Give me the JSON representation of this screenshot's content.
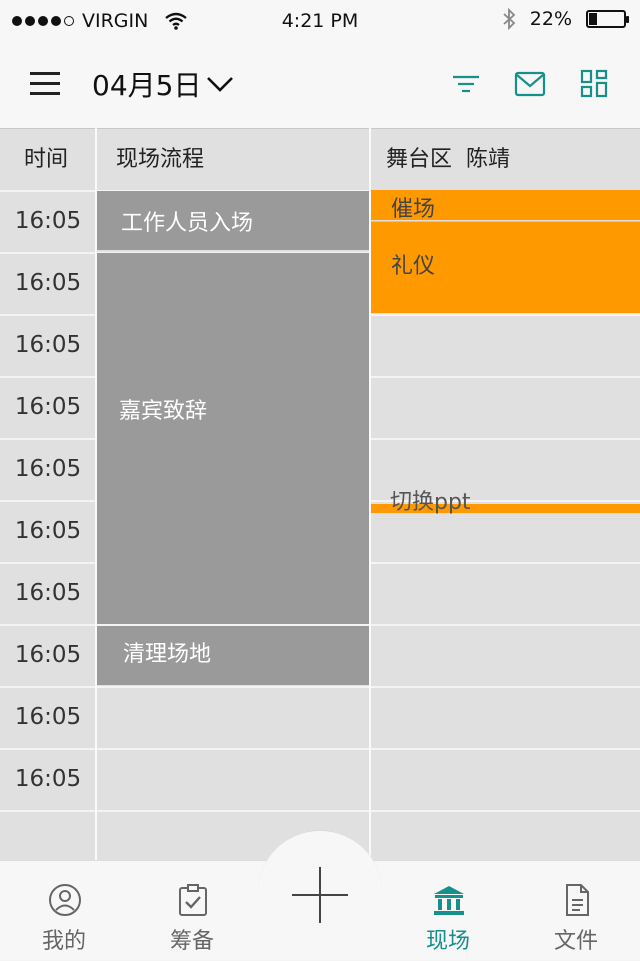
{
  "status_bar": {
    "carrier": "VIRGIN",
    "time": "4:21 PM",
    "battery": "22%",
    "battery_level": 0.22,
    "icons": [
      "signal-dots-icon",
      "wifi-icon",
      "bluetooth-icon",
      "battery-icon"
    ]
  },
  "navbar": {
    "date": "04月5日",
    "icons": [
      "menu-icon",
      "chevron-down-icon",
      "filter-icon",
      "mail-icon",
      "grid-icon"
    ],
    "accent_color": "#17908b"
  },
  "table": {
    "headers": [
      "时间",
      "现场流程",
      "舞台区  陈靖"
    ],
    "times": [
      "16:05",
      "16:05",
      "16:05",
      "16:05",
      "16:05",
      "16:05",
      "16:05",
      "16:05",
      "16:05",
      "16:05"
    ],
    "flow_items": [
      "工作人员入场",
      "嘉宾致辞",
      "清理场地"
    ],
    "stage_items": [
      "催场",
      "礼仪",
      "切换ppt"
    ],
    "colors": {
      "flow": "#9a9a9a",
      "stage": "#ff9900",
      "background": "#e0e0e0"
    }
  },
  "tabbar": {
    "tabs": [
      {
        "label": "我的",
        "icon": "user-circle-icon",
        "active": false
      },
      {
        "label": "筹备",
        "icon": "clipboard-check-icon",
        "active": false
      },
      {
        "label": "现场",
        "icon": "bank-building-icon",
        "active": true
      },
      {
        "label": "文件",
        "icon": "document-icon",
        "active": false
      }
    ],
    "add_icon": "plus-icon"
  }
}
